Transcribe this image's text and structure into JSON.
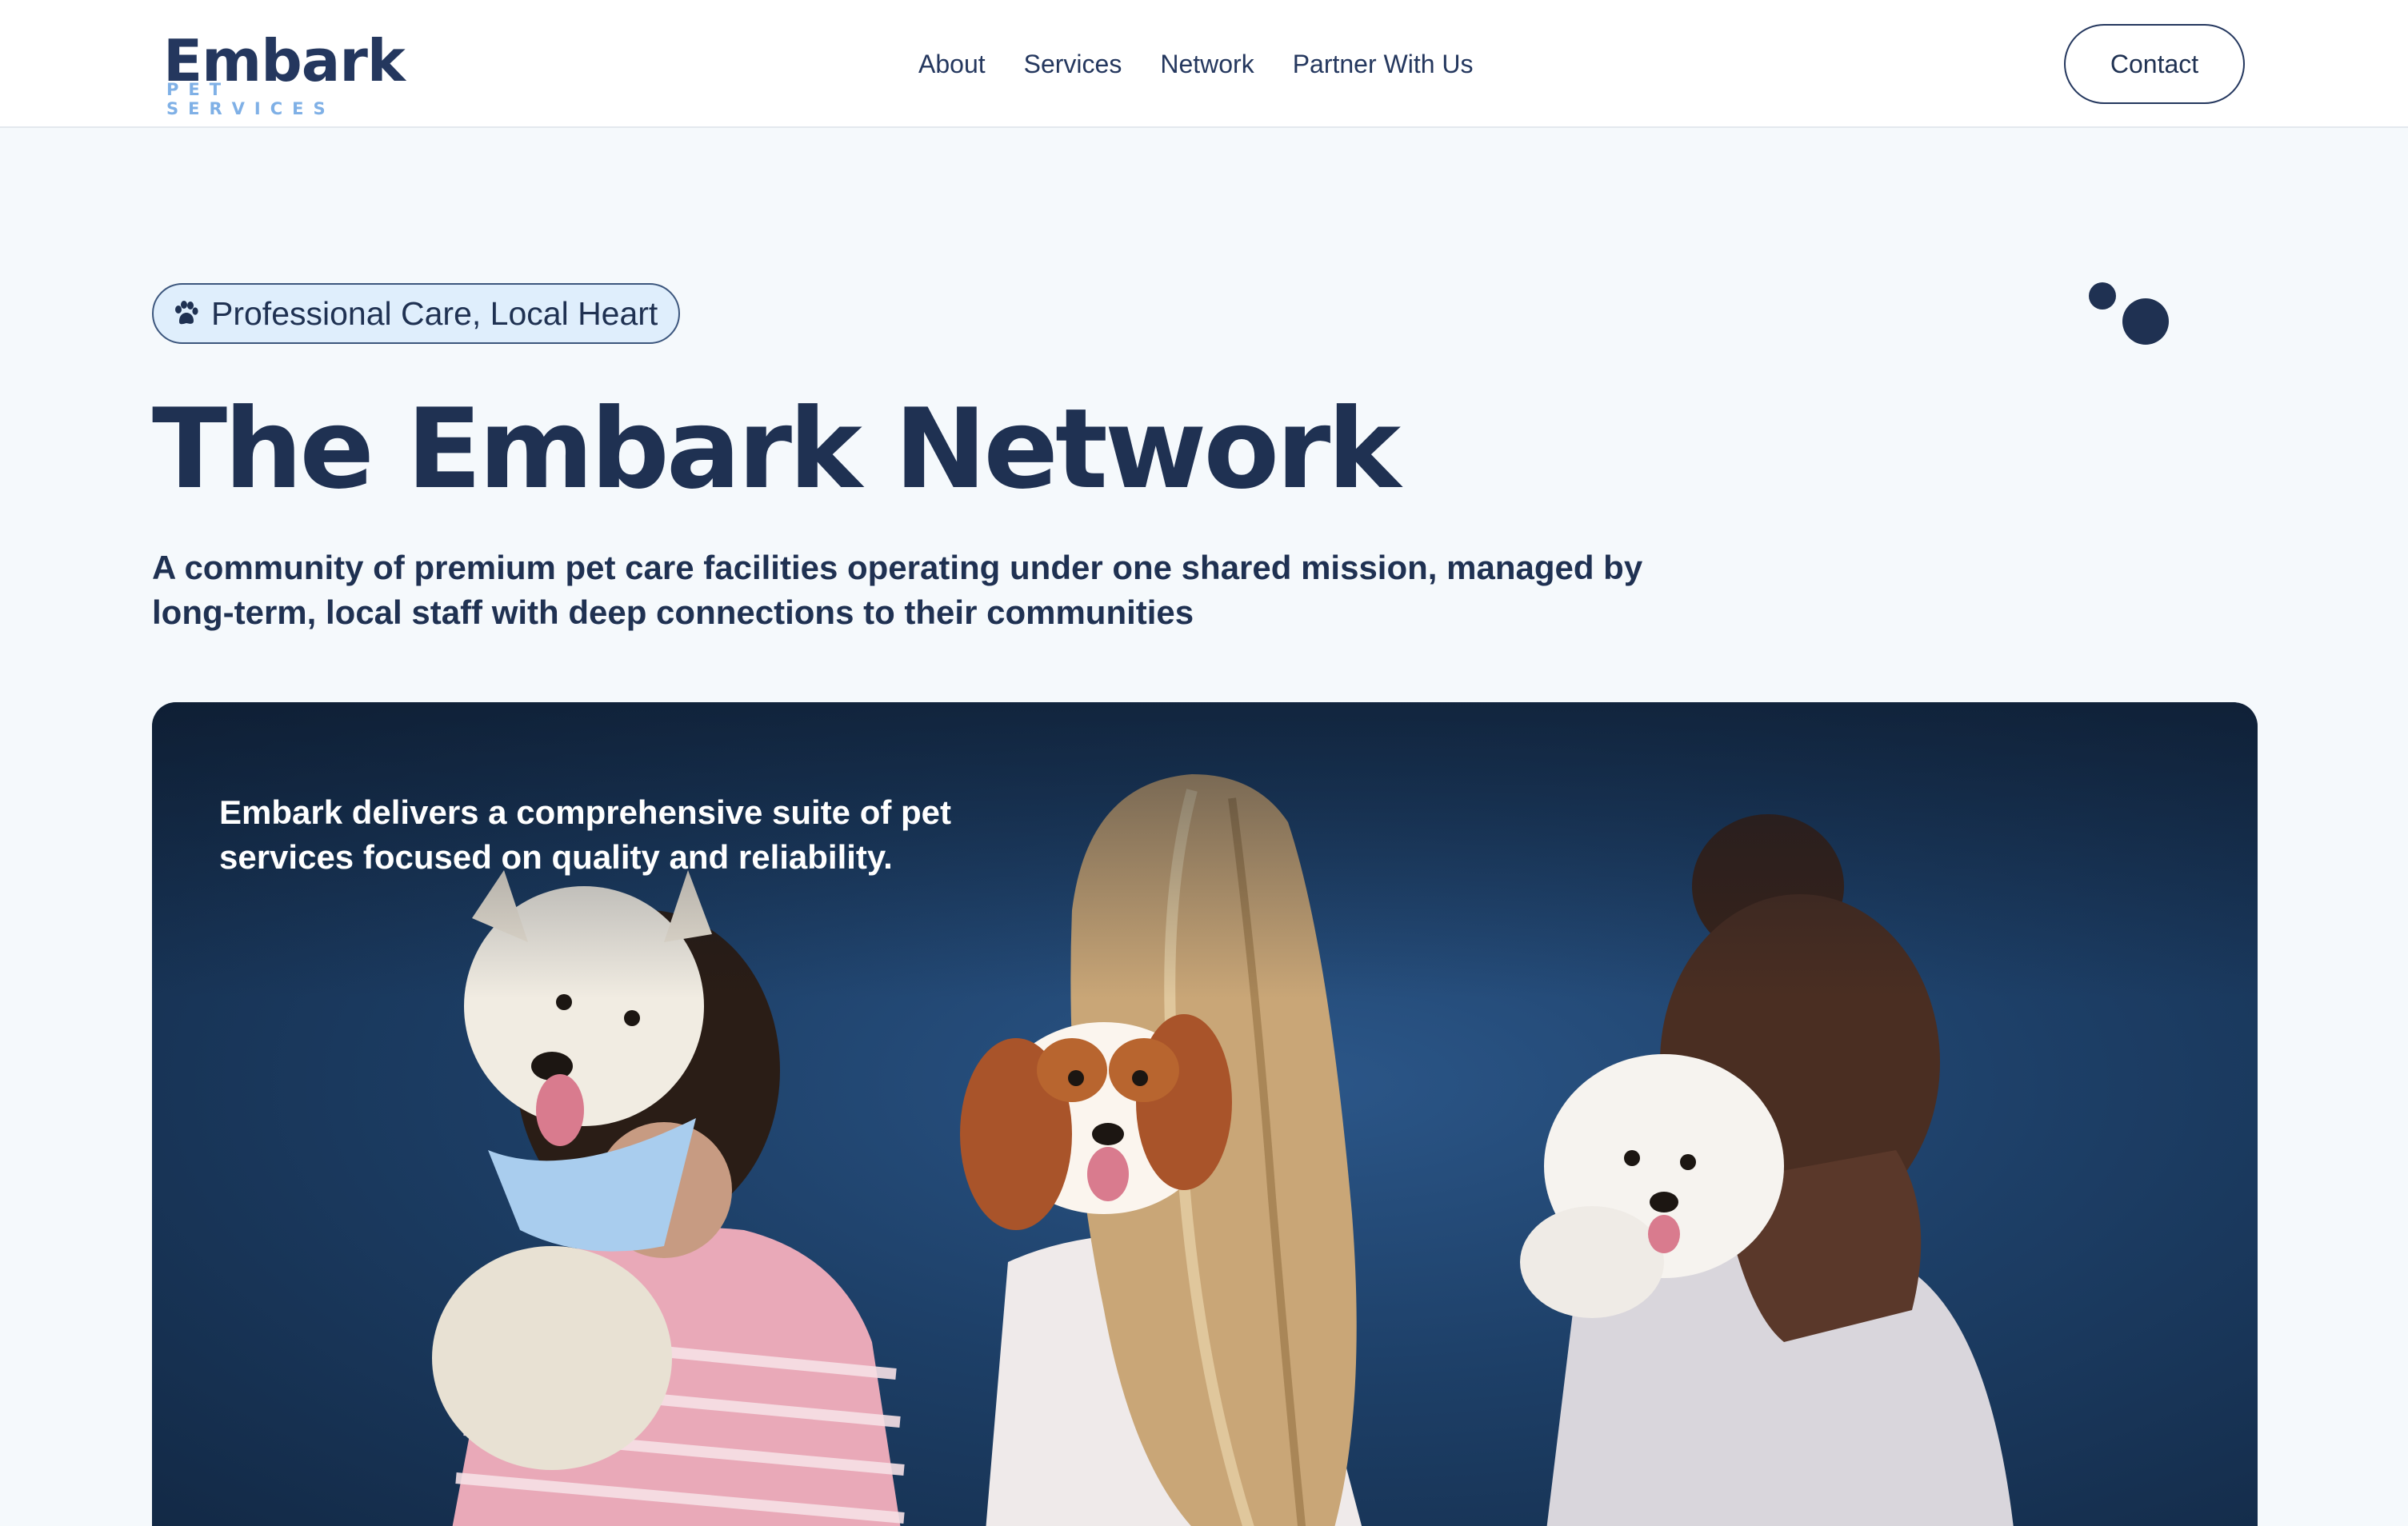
{
  "header": {
    "logo": {
      "word": "Embark",
      "sub": "PET SERVICES"
    },
    "nav": [
      {
        "label": "About"
      },
      {
        "label": "Services"
      },
      {
        "label": "Network"
      },
      {
        "label": "Partner With Us"
      }
    ],
    "contact_label": "Contact"
  },
  "hero": {
    "badge": {
      "icon": "paw-icon",
      "text": "Professional Care, Local Heart"
    },
    "title": "The Embark Network",
    "subtitle": "A community of premium pet care facilities operating under one shared mission, managed by long-term, local staff with deep connections to their communities"
  },
  "feature_card": {
    "text": "Embark delivers a comprehensive suite of pet services focused on quality and reliability."
  },
  "colors": {
    "primary": "#1f3152",
    "accent_light": "#dfeefc",
    "logo_sub": "#7fb0e6",
    "background": "#f5f9fc"
  }
}
